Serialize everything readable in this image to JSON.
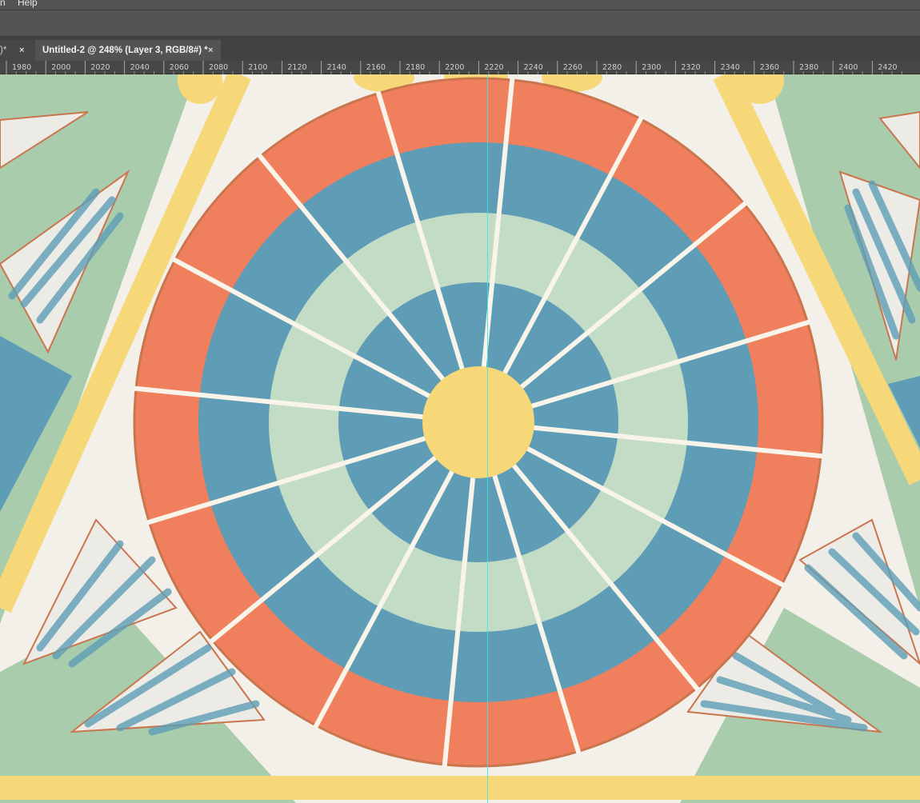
{
  "menu": {
    "items": [
      "n",
      "Help"
    ]
  },
  "tabs": [
    {
      "label": ")*",
      "close": "×"
    },
    {
      "label": "Untitled-2 @ 248% (Layer 3, RGB/8#) *",
      "close": "×"
    }
  ],
  "ruler": {
    "labels": [
      "1980",
      "2000",
      "2020",
      "2040",
      "2060",
      "2080",
      "2100",
      "2120",
      "2140",
      "2160",
      "2180",
      "2200",
      "2220",
      "2240",
      "2260",
      "2280",
      "2300",
      "2320",
      "2340",
      "2360",
      "2380",
      "2400",
      "2420"
    ]
  },
  "artwork": {
    "spokes": 16,
    "colors": {
      "background": "#f3efe9",
      "sage": "#a9ccad",
      "coral": "#f07f5e",
      "blue": "#5e9db5",
      "pale_green": "#c3dcc5",
      "yellow": "#f6d878",
      "spoke": "#f8f4ea",
      "outline": "#c9764e",
      "guide": "#36e6e6"
    }
  }
}
